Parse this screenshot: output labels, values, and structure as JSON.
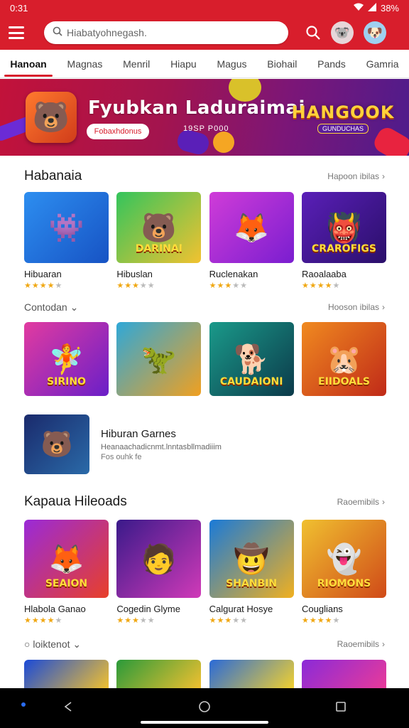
{
  "status_bar": {
    "time": "0:31",
    "battery": "38%"
  },
  "app_bar": {
    "search_placeholder": "Hiabatyohnegash."
  },
  "tabs": [
    {
      "label": "Hanoan",
      "active": true
    },
    {
      "label": "Magnas"
    },
    {
      "label": "Menril"
    },
    {
      "label": "Hiapu"
    },
    {
      "label": "Magus"
    },
    {
      "label": "Biohail"
    },
    {
      "label": "Pands"
    },
    {
      "label": "Gamria"
    }
  ],
  "banner": {
    "title": "Fyubkan Laduraimai",
    "button_label": "Fobaxhdonus",
    "subtitle": "19SP P000",
    "logo_big": "HANGOOK",
    "logo_small": "GUNDUCHAS"
  },
  "sections": {
    "s1": {
      "title": "Habanaia",
      "see_more": "Hapoon ibilas"
    },
    "s2": {
      "title": "Contodan",
      "see_more": "Hooson ibilas"
    },
    "s3": {
      "title": "Kapaua Hileoads",
      "see_more": "Raoemibils"
    },
    "s4": {
      "title": "loiktenot",
      "see_more": "Raoemibils"
    }
  },
  "row1": [
    {
      "name": "Hibuaran",
      "rating": 4,
      "caption": ""
    },
    {
      "name": "Hibuslan",
      "rating": 3,
      "caption": "DARINAI"
    },
    {
      "name": "Ruclenakan",
      "rating": 3,
      "caption": ""
    },
    {
      "name": "Raoalaaba",
      "rating": 4,
      "caption": "CRAROFIGS"
    }
  ],
  "row2": [
    {
      "caption": "SIRINO"
    },
    {
      "caption": ""
    },
    {
      "caption": "CAUDAIONI"
    },
    {
      "caption": "EIIDOALS"
    }
  ],
  "feature": {
    "title": "Hiburan Garnes",
    "description": "Heanaachadicnmt.lnntasbllmadiiim",
    "meta": "Fos ouhk fe"
  },
  "row3": [
    {
      "name": "Hlabola Ganao",
      "rating": 4,
      "caption": "SEAION"
    },
    {
      "name": "Cogedin Glyme",
      "rating": 3,
      "caption": ""
    },
    {
      "name": "Calgurat Hosye",
      "rating": 3,
      "caption": "SHANBIN"
    },
    {
      "name": "Couglians",
      "rating": 4,
      "caption": "RIOMONS"
    }
  ],
  "icons": {
    "menu": "hamburger-icon",
    "search": "magnifier-icon",
    "chevron": "chevron-right-icon"
  },
  "colors": {
    "brand": "#d81e2c"
  }
}
